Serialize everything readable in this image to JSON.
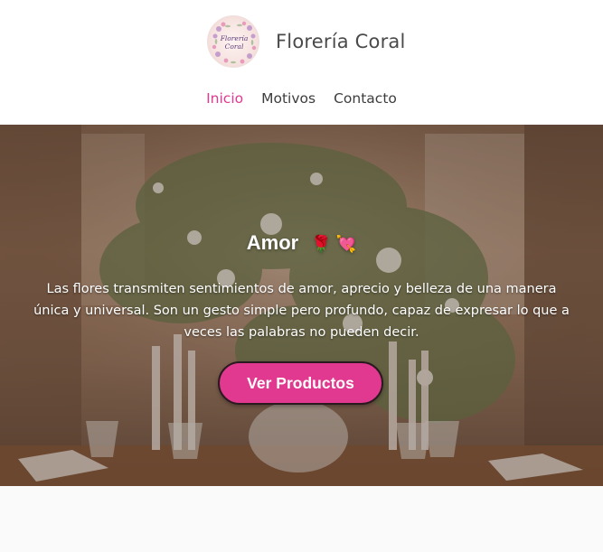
{
  "header": {
    "logo_text": [
      "Florería",
      "Coral"
    ],
    "brand_name": "Florería Coral"
  },
  "nav": {
    "items": [
      {
        "label": "Inicio",
        "active": true
      },
      {
        "label": "Motivos",
        "active": false
      },
      {
        "label": "Contacto",
        "active": false
      }
    ]
  },
  "hero": {
    "title": "Amor",
    "title_emoji": "🌹 💘",
    "text": "Las flores transmiten sentimientos de amor, aprecio y belleza de una manera única y universal. Son un gesto simple pero profundo, capaz de expresar lo que a veces las palabras no pueden decir.",
    "cta_label": "Ver Productos"
  },
  "colors": {
    "accent": "#e0398f",
    "header_bg": "#ffffff",
    "nav_text": "#3d3d3d",
    "page_bg": "#fafafa"
  }
}
